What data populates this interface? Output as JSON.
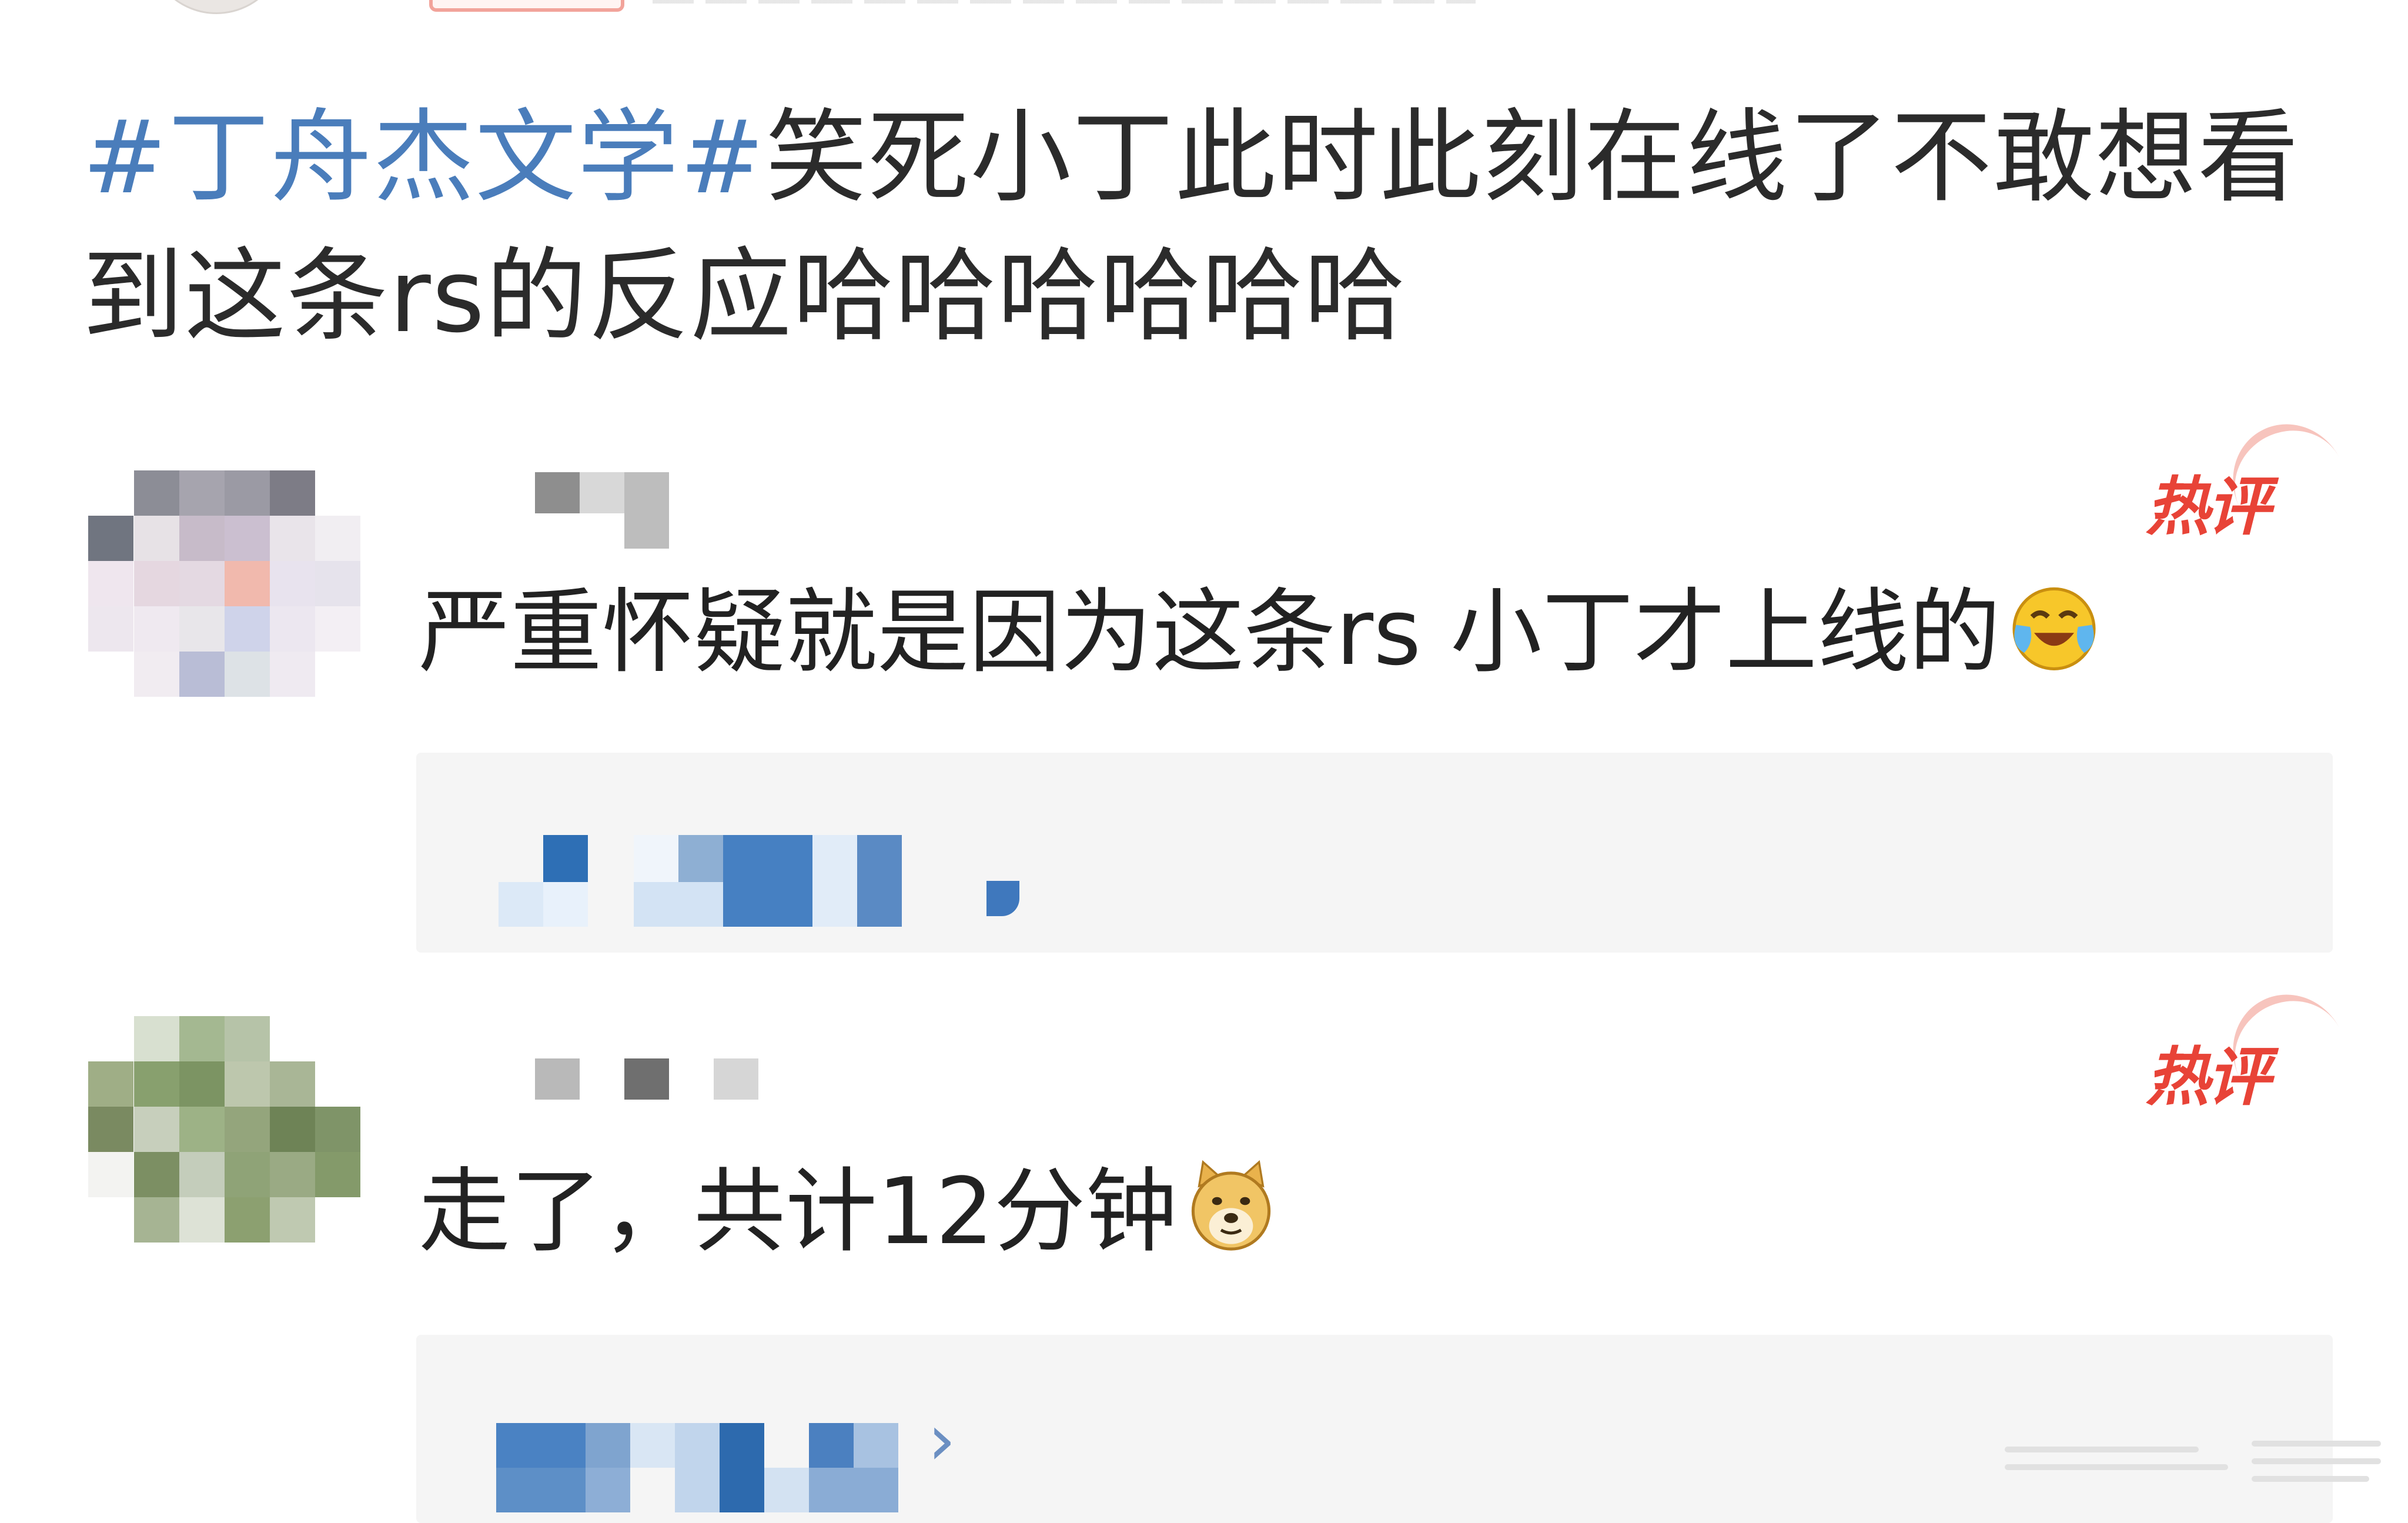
{
  "post": {
    "hashtag": "#丁舟杰文学#",
    "text": "笑死小丁此时此刻在线了不敢想看到这条rs的反应哈哈哈哈哈哈"
  },
  "comments": [
    {
      "hot_label": "热评",
      "text": "严重怀疑就是因为这条rs 小丁才上线的",
      "emoji": "laughing-crying-emoji"
    },
    {
      "hot_label": "热评",
      "text": "走了，共计12分钟",
      "emoji": "doge-emoji"
    }
  ],
  "reply_more_icon": "chevron-right-icon",
  "colors": {
    "hashtag": "#4a7dbb",
    "hot_label": "#e84337",
    "reply_box_bg": "#f5f5f5",
    "text": "#222222"
  }
}
